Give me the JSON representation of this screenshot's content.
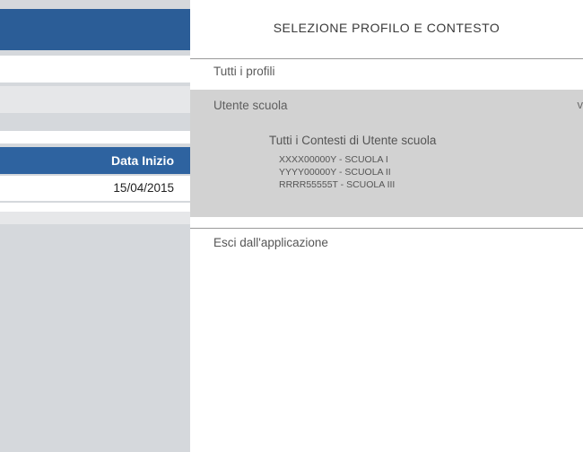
{
  "left_table": {
    "header_label": "Data Inizio",
    "rows": [
      {
        "data_inizio": "15/04/2015"
      }
    ]
  },
  "profile_menu": {
    "title": "SELEZIONE PROFILO E CONTESTO",
    "all_profiles_label": "Tutti i profili",
    "selected_profile": {
      "name": "Utente scuola",
      "chevron": "v",
      "all_contexts_label": "Tutti i Contesti di Utente scuola",
      "contexts": [
        "XXXX00000Y - SCUOLA I",
        "YYYY00000Y - SCUOLA II",
        "RRRR55555T - SCUOLA III"
      ]
    },
    "exit_label": "Esci dall'applicazione"
  },
  "colors": {
    "header_blue": "#2b5d97",
    "table_header_blue": "#2e63a0",
    "selected_profile_bg": "#d2d2d2"
  }
}
